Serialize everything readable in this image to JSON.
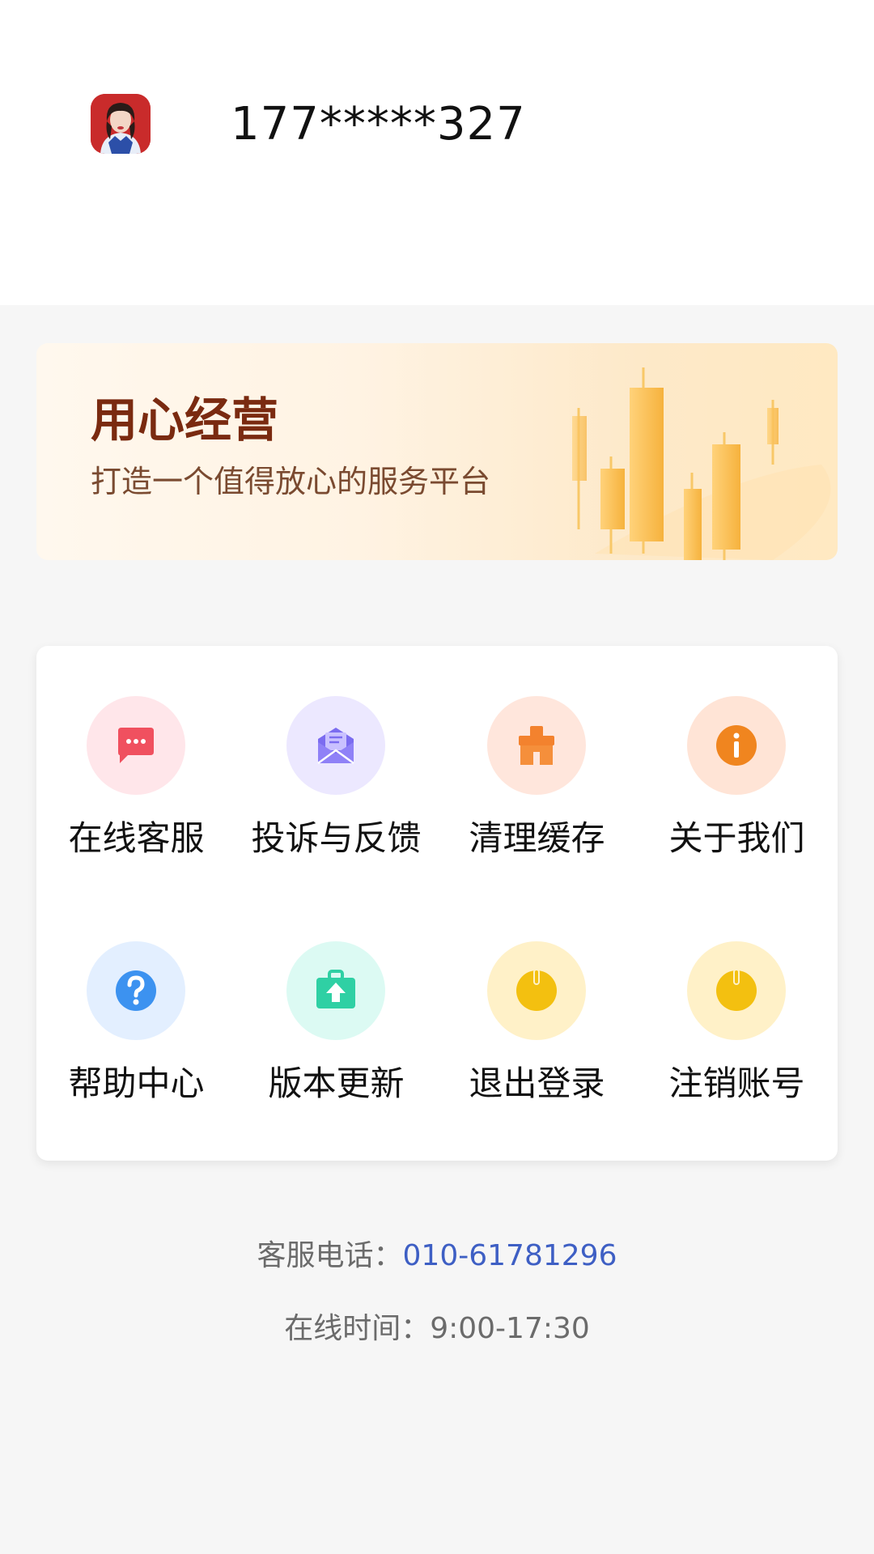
{
  "profile": {
    "phone_masked": "177*****327",
    "avatar_icon": "user-avatar"
  },
  "banner": {
    "title": "用心经营",
    "subtitle": "打造一个值得放心的服务平台"
  },
  "menu": {
    "items": [
      {
        "label": "在线客服",
        "icon": "chat-bubble-icon",
        "bg": "#ffe6ea",
        "fg": "#f0505f"
      },
      {
        "label": "投诉与反馈",
        "icon": "mail-icon",
        "bg": "#ece8ff",
        "fg": "#7b6cf0"
      },
      {
        "label": "清理缓存",
        "icon": "broom-icon",
        "bg": "#ffe6dc",
        "fg": "#f3822e"
      },
      {
        "label": "关于我们",
        "icon": "info-icon",
        "bg": "#ffe4d6",
        "fg": "#f0851f"
      },
      {
        "label": "帮助中心",
        "icon": "question-icon",
        "bg": "#e3efff",
        "fg": "#3c92f0"
      },
      {
        "label": "版本更新",
        "icon": "upgrade-icon",
        "bg": "#dcfaf3",
        "fg": "#2fd0a4"
      },
      {
        "label": "退出登录",
        "icon": "power-icon",
        "bg": "#fff1c8",
        "fg": "#f3c010"
      },
      {
        "label": "注销账号",
        "icon": "power-icon",
        "bg": "#fff1c8",
        "fg": "#f3c010"
      }
    ]
  },
  "contact": {
    "phone_label": "客服电话：",
    "phone_number": "010-61781296",
    "hours_label": "在线时间：",
    "hours_value": "9:00-17:30"
  }
}
